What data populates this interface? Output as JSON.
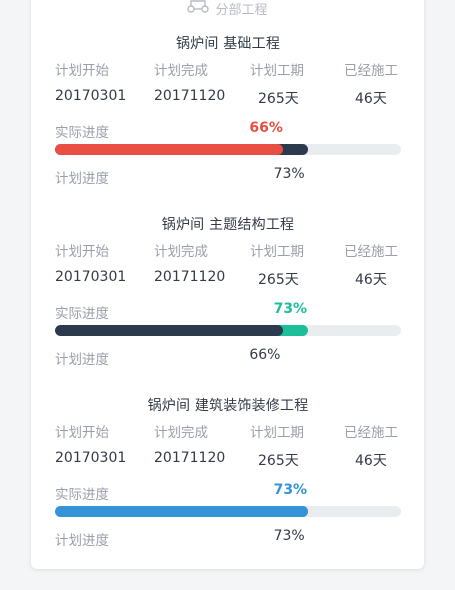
{
  "top_partial_label": "分部工程",
  "column_labels": {
    "plan_start": "计划开始",
    "plan_finish": "计划完成",
    "plan_duration": "计划工期",
    "elapsed": "已经施工"
  },
  "row_labels": {
    "actual_progress": "实际进度",
    "planned_progress": "计划进度"
  },
  "sections": [
    {
      "title": "锅炉间 基础工程",
      "plan_start": "20170301",
      "plan_finish": "20171120",
      "plan_duration": "265天",
      "elapsed": "46天",
      "actual_progress_text": "66%",
      "planned_progress_text": "73%",
      "actual_progress": 0.66,
      "planned_progress": 0.73,
      "actual_color": "#e94f42",
      "planned_color": "#2d3a4d"
    },
    {
      "title": "锅炉间 主题结构工程",
      "plan_start": "20170301",
      "plan_finish": "20171120",
      "plan_duration": "265天",
      "elapsed": "46天",
      "actual_progress_text": "73%",
      "planned_progress_text": "66%",
      "actual_progress": 0.73,
      "planned_progress": 0.66,
      "actual_color": "#1dbf9a",
      "planned_color": "#2d3a4d"
    },
    {
      "title": "锅炉间 建筑装饰装修工程",
      "plan_start": "20170301",
      "plan_finish": "20171120",
      "plan_duration": "265天",
      "elapsed": "46天",
      "actual_progress_text": "73%",
      "planned_progress_text": "73%",
      "actual_progress": 0.73,
      "planned_progress": 0.73,
      "actual_color": "#3593d8",
      "planned_color": "#3593d8"
    }
  ]
}
